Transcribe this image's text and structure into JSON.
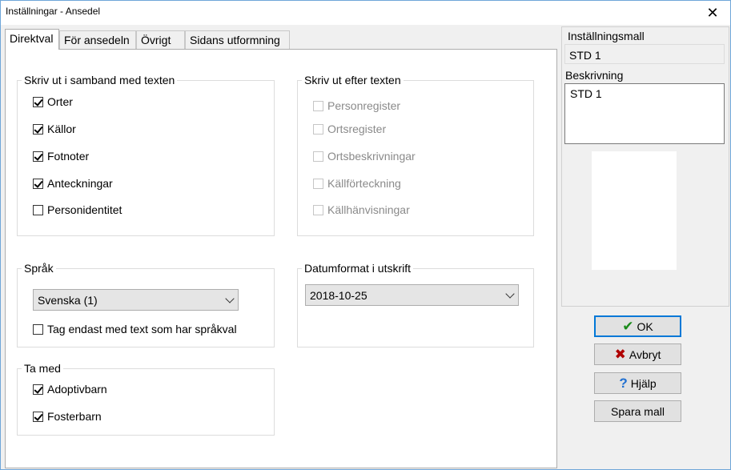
{
  "window": {
    "title": "Inställningar - Ansedel",
    "close_glyph": "✕"
  },
  "tabs": [
    {
      "label": "Direktval",
      "active": true
    },
    {
      "label": "För ansedeln",
      "active": false
    },
    {
      "label": "Övrigt",
      "active": false
    },
    {
      "label": "Sidans utformning",
      "active": false
    }
  ],
  "print_with_text": {
    "legend": "Skriv ut i samband med texten",
    "items": [
      {
        "label": "Orter",
        "checked": true
      },
      {
        "label": "Källor",
        "checked": true
      },
      {
        "label": "Fotnoter",
        "checked": true
      },
      {
        "label": "Anteckningar",
        "checked": true
      },
      {
        "label": "Personidentitet",
        "checked": false
      }
    ]
  },
  "print_after_text": {
    "legend": "Skriv ut efter texten",
    "items": [
      {
        "label": "Personregister",
        "checked": false,
        "disabled": true
      },
      {
        "label": "Ortsregister",
        "checked": false,
        "disabled": true
      },
      {
        "label": "Ortsbeskrivningar",
        "checked": false,
        "disabled": true
      },
      {
        "label": "Källförteckning",
        "checked": false,
        "disabled": true
      },
      {
        "label": "Källhänvisningar",
        "checked": false,
        "disabled": true
      }
    ]
  },
  "language": {
    "legend": "Språk",
    "selected": "Svenska (1)",
    "tag_only_label": "Tag endast med text som har språkval",
    "tag_only_checked": false
  },
  "date_format": {
    "legend": "Datumformat i utskrift",
    "selected": "2018-10-25"
  },
  "include": {
    "legend": "Ta med",
    "items": [
      {
        "label": "Adoptivbarn",
        "checked": true
      },
      {
        "label": "Fosterbarn",
        "checked": true
      }
    ]
  },
  "template_panel": {
    "template_label": "Inställningsmall",
    "template_value": "STD 1",
    "description_label": "Beskrivning",
    "description_value": "STD 1"
  },
  "buttons": {
    "ok": "OK",
    "cancel": "Avbryt",
    "help": "Hjälp",
    "save_template": "Spara mall"
  },
  "icons": {
    "ok": "check-icon",
    "cancel": "x-icon",
    "help": "question-icon"
  },
  "colors": {
    "accent": "#0078d7",
    "ok_icon": "#1a8a1a",
    "cancel_icon": "#b00000",
    "help_icon": "#1f6fd1"
  }
}
